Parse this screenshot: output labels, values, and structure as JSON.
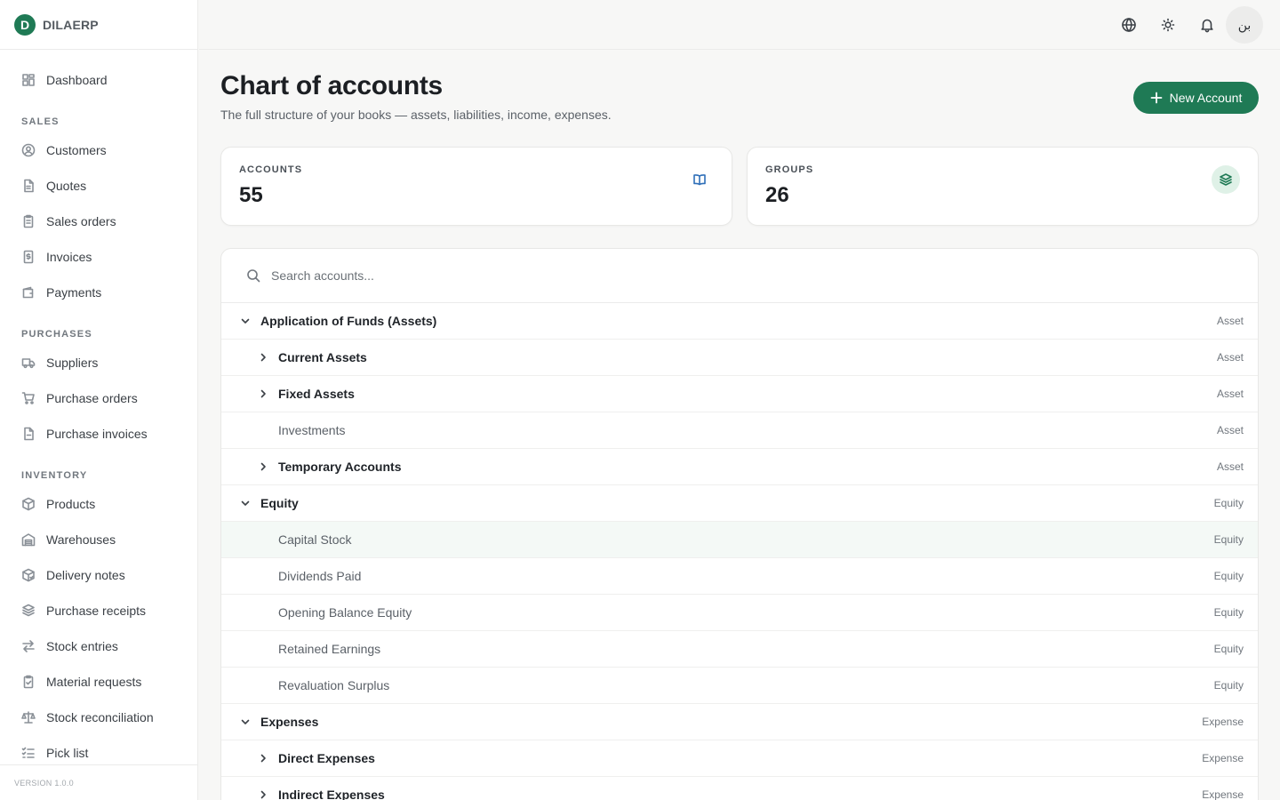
{
  "brand": {
    "logo_letter": "D",
    "name": "DILAERP",
    "accent": "#1f7a55"
  },
  "sidebar": {
    "dashboard": "Dashboard",
    "sections": [
      {
        "title": "SALES",
        "items": [
          "Customers",
          "Quotes",
          "Sales orders",
          "Invoices",
          "Payments"
        ]
      },
      {
        "title": "PURCHASES",
        "items": [
          "Suppliers",
          "Purchase orders",
          "Purchase invoices"
        ]
      },
      {
        "title": "INVENTORY",
        "items": [
          "Products",
          "Warehouses",
          "Delivery notes",
          "Purchase receipts",
          "Stock entries",
          "Material requests",
          "Stock reconciliation",
          "Pick list"
        ]
      }
    ],
    "version": "VERSION 1.0.0"
  },
  "topbar": {
    "icons": [
      "globe-icon",
      "sun-icon",
      "bell-icon"
    ],
    "avatar": "بن"
  },
  "page": {
    "title": "Chart of accounts",
    "subtitle": "The full structure of your books — assets, liabilities, income, expenses.",
    "new_button": "New Account"
  },
  "stats": [
    {
      "label": "ACCOUNTS",
      "value": "55",
      "icon": "book-icon"
    },
    {
      "label": "GROUPS",
      "value": "26",
      "icon": "layers-icon"
    }
  ],
  "search": {
    "placeholder": "Search accounts..."
  },
  "tree": [
    {
      "name": "Application of Funds (Assets)",
      "type": "Asset",
      "level": 0,
      "state": "expanded",
      "group": true
    },
    {
      "name": "Current Assets",
      "type": "Asset",
      "level": 1,
      "state": "collapsed",
      "group": true
    },
    {
      "name": "Fixed Assets",
      "type": "Asset",
      "level": 1,
      "state": "collapsed",
      "group": true
    },
    {
      "name": "Investments",
      "type": "Asset",
      "level": 1,
      "state": "leaf",
      "group": false
    },
    {
      "name": "Temporary Accounts",
      "type": "Asset",
      "level": 1,
      "state": "collapsed",
      "group": true
    },
    {
      "name": "Equity",
      "type": "Equity",
      "level": 0,
      "state": "expanded",
      "group": true
    },
    {
      "name": "Capital Stock",
      "type": "Equity",
      "level": 1,
      "state": "leaf",
      "group": false,
      "highlighted": true
    },
    {
      "name": "Dividends Paid",
      "type": "Equity",
      "level": 1,
      "state": "leaf",
      "group": false
    },
    {
      "name": "Opening Balance Equity",
      "type": "Equity",
      "level": 1,
      "state": "leaf",
      "group": false
    },
    {
      "name": "Retained Earnings",
      "type": "Equity",
      "level": 1,
      "state": "leaf",
      "group": false
    },
    {
      "name": "Revaluation Surplus",
      "type": "Equity",
      "level": 1,
      "state": "leaf",
      "group": false
    },
    {
      "name": "Expenses",
      "type": "Expense",
      "level": 0,
      "state": "expanded",
      "group": true
    },
    {
      "name": "Direct Expenses",
      "type": "Expense",
      "level": 1,
      "state": "collapsed",
      "group": true
    },
    {
      "name": "Indirect Expenses",
      "type": "Expense",
      "level": 1,
      "state": "collapsed",
      "group": true
    }
  ]
}
